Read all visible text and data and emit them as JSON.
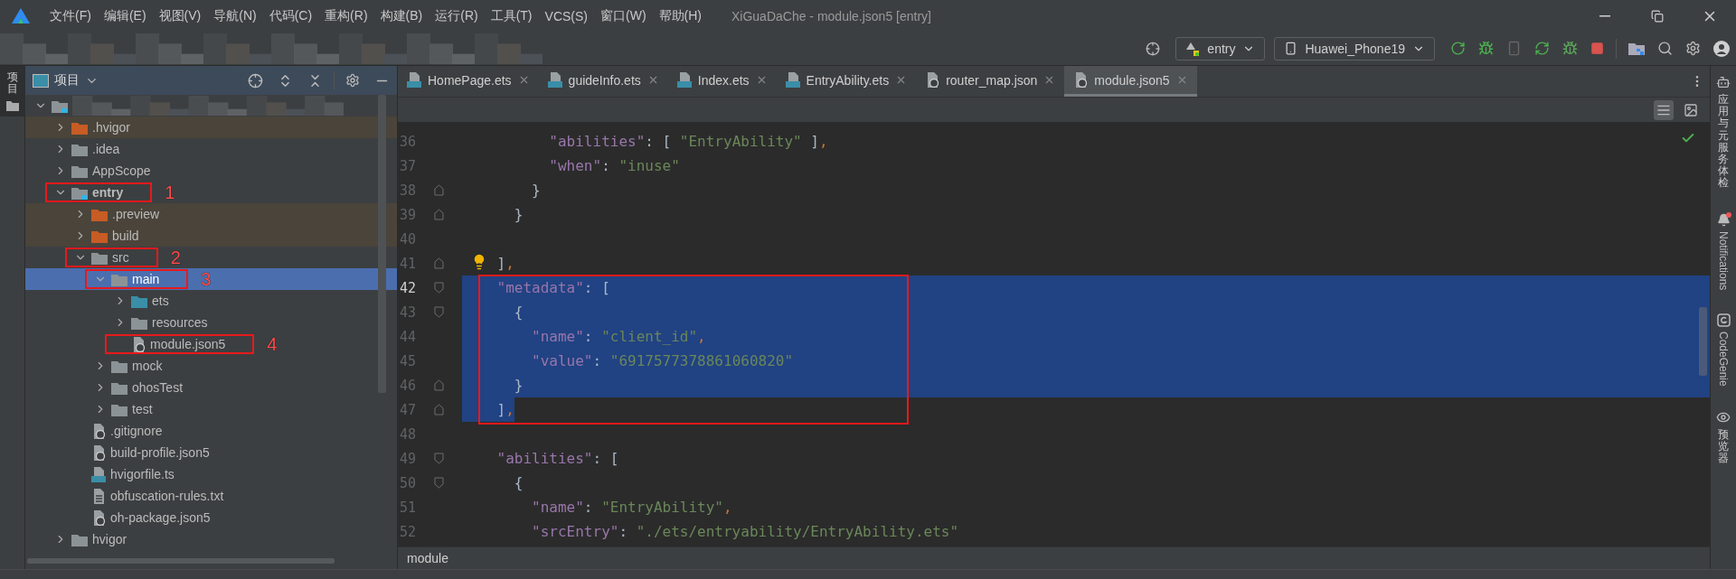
{
  "window": {
    "title": "XiGuaDaChe - module.json5 [entry]"
  },
  "menu": [
    "文件(F)",
    "编辑(E)",
    "视图(V)",
    "导航(N)",
    "代码(C)",
    "重构(R)",
    "构建(B)",
    "运行(R)",
    "工具(T)",
    "VCS(S)",
    "窗口(W)",
    "帮助(H)"
  ],
  "toolbar": {
    "navigation_redacted": true,
    "run_config": "entry",
    "device": "Huawei_Phone19"
  },
  "left_strip": {
    "tabs": [
      {
        "label": "项目",
        "selected": true
      }
    ]
  },
  "project_panel": {
    "title": "项目",
    "tree": [
      {
        "kind": "module",
        "redacted": true,
        "expanded": true,
        "selected": false,
        "children": [
          {
            "kind": "folder",
            "label": ".hvigor",
            "excluded": true,
            "expanded": false,
            "selected": false
          },
          {
            "kind": "folder",
            "label": ".idea",
            "expanded": false,
            "selected": false
          },
          {
            "kind": "folder",
            "label": "AppScope",
            "expanded": false,
            "selected": false
          },
          {
            "kind": "module",
            "label": "entry",
            "expanded": true,
            "selected": false,
            "annotation": "1",
            "children": [
              {
                "kind": "folder",
                "label": ".preview",
                "excluded": true,
                "expanded": false,
                "selected": false
              },
              {
                "kind": "folder",
                "label": "build",
                "excluded": true,
                "expanded": false,
                "selected": false
              },
              {
                "kind": "folder",
                "label": "src",
                "expanded": true,
                "selected": false,
                "annotation": "2",
                "children": [
                  {
                    "kind": "folder",
                    "label": "main",
                    "expanded": true,
                    "selected": true,
                    "annotation": "3",
                    "children": [
                      {
                        "kind": "source",
                        "label": "ets",
                        "expanded": false,
                        "selected": false
                      },
                      {
                        "kind": "folder",
                        "label": "resources",
                        "expanded": false,
                        "selected": false
                      },
                      {
                        "kind": "json",
                        "label": "module.json5",
                        "selected": false,
                        "annotation": "4"
                      }
                    ]
                  },
                  {
                    "kind": "folder",
                    "label": "mock",
                    "expanded": false,
                    "selected": false
                  },
                  {
                    "kind": "folder",
                    "label": "ohosTest",
                    "expanded": false,
                    "selected": false
                  },
                  {
                    "kind": "folder",
                    "label": "test",
                    "expanded": false,
                    "selected": false
                  }
                ]
              },
              {
                "kind": "ignore",
                "label": ".gitignore",
                "selected": false
              },
              {
                "kind": "json",
                "label": "build-profile.json5",
                "selected": false
              },
              {
                "kind": "ts",
                "label": "hvigorfile.ts",
                "selected": false
              },
              {
                "kind": "text",
                "label": "obfuscation-rules.txt",
                "selected": false
              },
              {
                "kind": "json",
                "label": "oh-package.json5",
                "selected": false
              }
            ]
          },
          {
            "kind": "folder",
            "label": "hvigor",
            "expanded": false,
            "selected": false
          }
        ]
      }
    ]
  },
  "editor": {
    "tabs": [
      {
        "label": "HomePage.ets",
        "kind": "ets",
        "selected": false
      },
      {
        "label": "guideInfo.ets",
        "kind": "ets",
        "selected": false
      },
      {
        "label": "Index.ets",
        "kind": "ets",
        "selected": false
      },
      {
        "label": "EntryAbility.ets",
        "kind": "ets",
        "selected": false
      },
      {
        "label": "router_map.json",
        "kind": "json",
        "selected": false
      },
      {
        "label": "module.json5",
        "kind": "json",
        "selected": true
      }
    ],
    "lines": [
      {
        "number": "36",
        "text": "          \"abilities\": [ \"EntryAbility\" ],",
        "selected": false
      },
      {
        "number": "37",
        "text": "          \"when\": \"inuse\"",
        "selected": false
      },
      {
        "number": "38",
        "text": "        }",
        "selected": false
      },
      {
        "number": "39",
        "text": "      }",
        "selected": false
      },
      {
        "number": "40",
        "selected": false
      },
      {
        "number": "41",
        "text": "    ],",
        "selected": false,
        "bulb": true
      },
      {
        "kind": "annotated_block",
        "lines": [
          {
            "number": "42",
            "text": "    \"metadata\": [",
            "selected": true,
            "current": true
          },
          {
            "number": "43",
            "text": "      {",
            "selected": true
          },
          {
            "number": "44",
            "text": "        \"name\": \"client_id\",",
            "selected": true
          },
          {
            "number": "45",
            "text": "        \"value\": \"6917577378861060820\"",
            "selected": true
          },
          {
            "number": "46",
            "text": "      }",
            "selected": true
          },
          {
            "number": "47",
            "text": "    ],",
            "selected": true
          }
        ]
      },
      {
        "number": "48",
        "selected": false
      },
      {
        "number": "49",
        "text": "    \"abilities\": [",
        "selected": false
      },
      {
        "number": "50",
        "text": "      {",
        "selected": false
      },
      {
        "number": "51",
        "text": "        \"name\": \"EntryAbility\",",
        "selected": false
      },
      {
        "number": "52",
        "text": "        \"srcEntry\": \"./ets/entryability/EntryAbility.ets\"",
        "selected": false
      }
    ],
    "breadcrumb": "module"
  },
  "right_strip": [
    {
      "label": "应用与元服务体检",
      "kind": "cjk",
      "badge": false
    },
    {
      "label": "Notifications",
      "kind": "latin",
      "badge": true
    },
    {
      "label": "CodeGenie",
      "kind": "latin",
      "badge": false
    },
    {
      "label": "预览器",
      "kind": "cjk",
      "badge": false
    }
  ]
}
